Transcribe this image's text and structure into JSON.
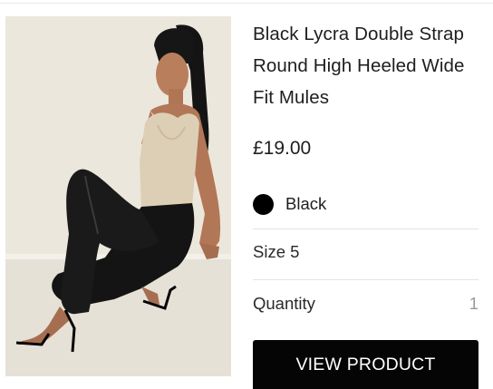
{
  "product": {
    "title_lines": [
      "Black Lycra Double Strap",
      "Round High Heeled Wide",
      "Fit Mules"
    ],
    "price": "£19.00",
    "colour": {
      "label": "Black",
      "swatch": "#000000"
    },
    "size": "Size 5",
    "quantity": {
      "label": "Quantity",
      "value": "1"
    },
    "cta_label": "VIEW PRODUCT"
  },
  "image": {
    "icon": "product-photo",
    "alt": ""
  },
  "colors": {
    "cta_bg": "#050505",
    "cta_text": "#ffffff",
    "divider": "#e3e3e3"
  }
}
